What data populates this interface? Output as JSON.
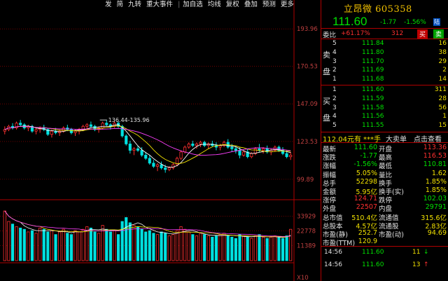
{
  "toolbar": [
    "发",
    "简",
    "九转",
    "重大事件",
    "加自选",
    "均线",
    "复权",
    "叠加",
    "预测",
    "更多"
  ],
  "stock": {
    "name": "立昂微 605358",
    "price": "111.60",
    "change": "-1.77",
    "pct": "-1.56%",
    "board": "陆"
  },
  "webi": {
    "label": "委比",
    "value": "+61.17%",
    "diff": "312",
    "buy": "买",
    "sell": "卖"
  },
  "sell_label": [
    "卖",
    "盘"
  ],
  "buy_label": [
    "买",
    "盘"
  ],
  "sells": [
    {
      "lv": "5",
      "p": "111.84",
      "v": "16"
    },
    {
      "lv": "4",
      "p": "111.80",
      "v": "38"
    },
    {
      "lv": "3",
      "p": "111.70",
      "v": "29"
    },
    {
      "lv": "2",
      "p": "111.69",
      "v": "2"
    },
    {
      "lv": "1",
      "p": "111.68",
      "v": "14"
    }
  ],
  "buys": [
    {
      "lv": "1",
      "p": "111.60",
      "v": "311"
    },
    {
      "lv": "2",
      "p": "111.59",
      "v": "28"
    },
    {
      "lv": "3",
      "p": "111.58",
      "v": "56"
    },
    {
      "lv": "4",
      "p": "111.56",
      "v": "1"
    },
    {
      "lv": "5",
      "p": "111.55",
      "v": "15"
    }
  ],
  "bigorder": {
    "price": "112.04元有",
    "hand": "***手",
    "label": "大卖单",
    "link": "点击查看"
  },
  "quotes": [
    {
      "l1": "最新",
      "v1": "111.60",
      "c1": "#00e000",
      "l2": "开盘",
      "v2": "113.36",
      "c2": "#ff3030"
    },
    {
      "l1": "涨跌",
      "v1": "-1.77",
      "c1": "#00e000",
      "l2": "最高",
      "v2": "116.53",
      "c2": "#ff3030"
    },
    {
      "l1": "涨幅",
      "v1": "-1.56%",
      "c1": "#00e000",
      "l2": "最低",
      "v2": "110.81",
      "c2": "#00e000"
    },
    {
      "l1": "振幅",
      "v1": "5.05%",
      "c1": "#f0e000",
      "l2": "量比",
      "v2": "1.62",
      "c2": "#f0e000"
    },
    {
      "l1": "总手",
      "v1": "52298",
      "c1": "#f0e000",
      "l2": "换手",
      "v2": "1.85%",
      "c2": "#f0e000"
    },
    {
      "l1": "金额",
      "v1": "5.95亿",
      "c1": "#f0e000",
      "l2": "换手(实)",
      "v2": "1.85%",
      "c2": "#f0e000"
    },
    {
      "l1": "涨停",
      "v1": "124.71",
      "c1": "#ff3030",
      "l2": "跌停",
      "v2": "102.03",
      "c2": "#00e000"
    },
    {
      "l1": "外盘",
      "v1": "22507",
      "c1": "#ff3030",
      "l2": "内盘",
      "v2": "29791",
      "c2": "#00e000"
    },
    {
      "l1": "总市值",
      "v1": "510.4亿",
      "c1": "#f0e000",
      "l2": "流通值",
      "v2": "315.6亿",
      "c2": "#f0e000"
    },
    {
      "l1": "总股本",
      "v1": "4.57亿",
      "c1": "#f0e000",
      "l2": "流通股",
      "v2": "2.83亿",
      "c2": "#f0e000"
    },
    {
      "l1": "市盈(静)",
      "v1": "252.7",
      "c1": "#f0e000",
      "l2": "市盈(动)",
      "v2": "94.69",
      "c2": "#f0e000"
    },
    {
      "l1": "市盈(TTM)",
      "v1": "120.9",
      "c1": "#f0e000",
      "l2": "",
      "v2": "",
      "c2": "#f0e000"
    }
  ],
  "ticks": [
    {
      "t": "14:56",
      "p": "111.60",
      "v": "11",
      "a": "↓"
    },
    {
      "t": "14:56",
      "p": "111.60",
      "v": "13",
      "a": "↑"
    }
  ],
  "colors": {
    "up": "#ff3030",
    "down": "#00e0e0",
    "ma5": "#ffffff",
    "ma10": "#f0e000",
    "ma20": "#ff40ff",
    "grid": "#b00000",
    "border": "#b00000"
  },
  "chart_data": {
    "type": "candlestick",
    "price_ticks": [
      "193.96",
      "170.53",
      "147.09",
      "123.53",
      "99.89"
    ],
    "price_range": [
      88,
      205
    ],
    "volume_ticks": [
      "33929",
      "22778",
      "11389"
    ],
    "volume_range": [
      0,
      45000
    ],
    "volume_axis_label": "X10",
    "annotation": "136.44-135.96",
    "candles": [
      [
        130,
        133,
        128,
        131
      ],
      [
        131,
        134,
        130,
        133
      ],
      [
        133,
        135,
        131,
        132
      ],
      [
        132,
        136,
        131,
        135
      ],
      [
        135,
        137,
        133,
        134
      ],
      [
        134,
        135,
        131,
        132
      ],
      [
        132,
        134,
        130,
        133
      ],
      [
        133,
        134,
        129,
        130
      ],
      [
        130,
        132,
        128,
        131
      ],
      [
        131,
        133,
        129,
        132
      ],
      [
        132,
        134,
        130,
        131
      ],
      [
        131,
        132,
        127,
        128
      ],
      [
        128,
        131,
        126,
        130
      ],
      [
        130,
        132,
        128,
        129
      ],
      [
        129,
        131,
        127,
        130
      ],
      [
        130,
        133,
        129,
        132
      ],
      [
        132,
        134,
        130,
        131
      ],
      [
        131,
        132,
        128,
        129
      ],
      [
        129,
        131,
        127,
        130
      ],
      [
        130,
        132,
        128,
        131
      ],
      [
        131,
        134,
        130,
        133
      ],
      [
        133,
        135,
        131,
        134
      ],
      [
        134,
        136,
        132,
        133
      ],
      [
        133,
        134,
        130,
        131
      ],
      [
        131,
        133,
        129,
        132
      ],
      [
        132,
        136,
        131,
        135
      ],
      [
        135,
        137,
        133,
        134
      ],
      [
        134,
        135,
        131,
        133
      ],
      [
        133,
        136,
        132,
        135
      ],
      [
        135,
        136,
        132,
        133
      ],
      [
        133,
        134,
        126,
        127
      ],
      [
        127,
        128,
        121,
        122
      ],
      [
        122,
        124,
        116,
        118
      ],
      [
        118,
        120,
        115,
        119
      ],
      [
        119,
        121,
        117,
        118
      ],
      [
        118,
        120,
        114,
        115
      ],
      [
        115,
        117,
        112,
        113
      ],
      [
        113,
        115,
        109,
        110
      ],
      [
        110,
        112,
        107,
        108
      ],
      [
        108,
        110,
        105,
        109
      ],
      [
        109,
        111,
        106,
        107
      ],
      [
        107,
        109,
        104,
        106
      ],
      [
        106,
        108,
        105,
        107
      ],
      [
        107,
        110,
        106,
        109
      ],
      [
        109,
        114,
        108,
        113
      ],
      [
        113,
        118,
        112,
        117
      ],
      [
        117,
        121,
        116,
        120
      ],
      [
        120,
        123,
        119,
        122
      ],
      [
        122,
        124,
        120,
        121
      ],
      [
        121,
        123,
        119,
        122
      ],
      [
        122,
        124,
        120,
        123
      ],
      [
        123,
        124,
        120,
        121
      ],
      [
        121,
        123,
        119,
        122
      ],
      [
        122,
        124,
        120,
        121
      ],
      [
        121,
        123,
        118,
        120
      ],
      [
        120,
        122,
        118,
        121
      ],
      [
        121,
        124,
        120,
        123
      ],
      [
        123,
        125,
        119,
        120
      ],
      [
        120,
        122,
        117,
        119
      ],
      [
        119,
        121,
        116,
        118
      ],
      [
        118,
        120,
        113,
        115
      ],
      [
        115,
        118,
        114,
        117
      ],
      [
        117,
        119,
        113,
        114
      ],
      [
        114,
        117,
        113,
        116
      ],
      [
        116,
        120,
        115,
        119
      ],
      [
        119,
        122,
        117,
        118
      ],
      [
        118,
        120,
        116,
        119
      ],
      [
        119,
        121,
        116,
        117
      ],
      [
        117,
        119,
        115,
        118
      ],
      [
        118,
        121,
        117,
        120
      ],
      [
        120,
        121,
        117,
        118
      ],
      [
        118,
        120,
        115,
        116
      ],
      [
        116,
        118,
        113,
        114
      ],
      [
        114,
        117,
        112,
        115
      ]
    ],
    "volumes": [
      38,
      30,
      28,
      26,
      25,
      24,
      22,
      23,
      21,
      25,
      24,
      22,
      23,
      20,
      22,
      24,
      21,
      20,
      23,
      22,
      24,
      26,
      25,
      22,
      21,
      27,
      24,
      22,
      23,
      20,
      30,
      33,
      29,
      27,
      26,
      24,
      22,
      23,
      21,
      20,
      22,
      21,
      19,
      20,
      23,
      26,
      24,
      22,
      20,
      19,
      21,
      20,
      19,
      18,
      19,
      20,
      21,
      19,
      18,
      17,
      20,
      19,
      18,
      17,
      19,
      20,
      18,
      17,
      18,
      19,
      18,
      17,
      19,
      24
    ]
  }
}
